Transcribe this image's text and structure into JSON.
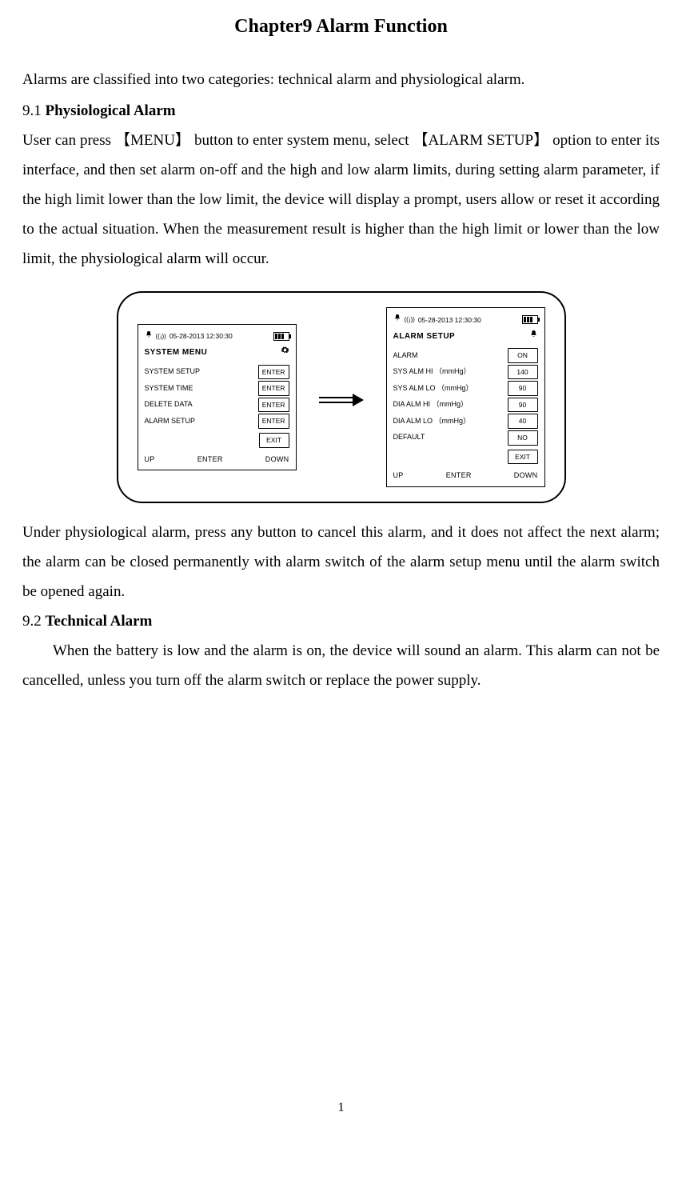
{
  "chapter_title": "Chapter9 Alarm Function",
  "intro": "Alarms are classified into two categories: technical alarm and physiological alarm.",
  "section1": {
    "num": "9.1",
    "name": "Physiological Alarm"
  },
  "body1": "User can press 【MENU】 button to enter system menu, select 【ALARM SETUP】 option to enter its interface, and then set alarm on-off and the high and low alarm limits, during setting alarm parameter, if the high limit lower than the low limit, the device will display a prompt, users allow or reset it according to the actual situation. When the measurement result is higher than the high limit or lower than the low limit, the physiological alarm will occur.",
  "screen_left": {
    "datetime": "05-28-2013  12:30:30",
    "title": "SYSTEM MENU",
    "items": [
      {
        "label": "SYSTEM SETUP",
        "button": "ENTER"
      },
      {
        "label": "SYSTEM TIME",
        "button": "ENTER"
      },
      {
        "label": "DELETE DATA",
        "button": "ENTER"
      },
      {
        "label": "ALARM SETUP",
        "button": "ENTER"
      }
    ],
    "exit": "EXIT",
    "bottom": {
      "up": "UP",
      "enter": "ENTER",
      "down": "DOWN"
    }
  },
  "screen_right": {
    "datetime": "05-28-2013  12:30:30",
    "title": "ALARM SETUP",
    "items": [
      {
        "label": "ALARM",
        "value": "ON"
      },
      {
        "label": "SYS ALM HI （mmHg）",
        "value": "140"
      },
      {
        "label": "SYS ALM LO （mmHg）",
        "value": "90"
      },
      {
        "label": "DIA ALM HI （mmHg）",
        "value": "90"
      },
      {
        "label": "DIA ALM LO （mmHg）",
        "value": "40"
      },
      {
        "label": "DEFAULT",
        "value": "NO"
      }
    ],
    "exit": "EXIT",
    "bottom": {
      "up": "UP",
      "enter": "ENTER",
      "down": "DOWN"
    }
  },
  "body2": "Under physiological alarm, press any button to cancel this alarm, and it does not affect the next alarm; the alarm can be closed permanently with alarm switch of the alarm setup menu until the alarm switch be opened again.",
  "section2": {
    "num": "9.2",
    "name": "Technical Alarm"
  },
  "body3": "When the battery is low and the alarm is on, the device will sound an alarm. This alarm can not be cancelled, unless you turn off the alarm switch or replace the power supply.",
  "page_number": "1"
}
